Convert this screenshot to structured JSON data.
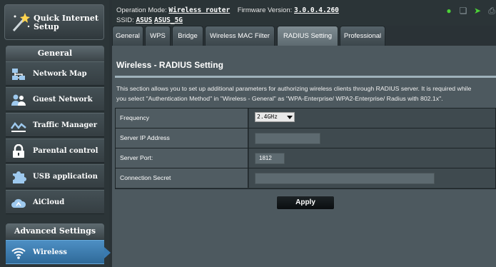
{
  "sidebar": {
    "quick_setup_label": "Quick Internet Setup",
    "general_header": "General",
    "items": [
      {
        "label": "Network Map",
        "icon": "network-map-icon"
      },
      {
        "label": "Guest Network",
        "icon": "guest-network-icon"
      },
      {
        "label": "Traffic Manager",
        "icon": "traffic-manager-icon"
      },
      {
        "label": "Parental control",
        "icon": "lock-icon"
      },
      {
        "label": "USB application",
        "icon": "puzzle-icon"
      },
      {
        "label": "AiCloud",
        "icon": "cloud-icon"
      }
    ],
    "advanced_header": "Advanced Settings",
    "advanced_items": [
      {
        "label": "Wireless",
        "icon": "wifi-icon",
        "active": true
      }
    ]
  },
  "topbar": {
    "operation_mode_label": "Operation Mode:",
    "operation_mode_value": "Wireless router",
    "firmware_label": "Firmware Version:",
    "firmware_value": "3.0.0.4.260",
    "ssid_label": "SSID:",
    "ssid_values": [
      "ASUS",
      "ASUS_5G"
    ],
    "status_icons": [
      "client-status-icon",
      "copy-icon",
      "usb-icon",
      "printer-icon"
    ]
  },
  "tabs": [
    {
      "label": "General"
    },
    {
      "label": "WPS"
    },
    {
      "label": "Bridge"
    },
    {
      "label": "Wireless MAC Filter"
    },
    {
      "label": "RADIUS Setting",
      "active": true
    },
    {
      "label": "Professional"
    }
  ],
  "main": {
    "title": "Wireless - RADIUS Setting",
    "description_line1": "This section allows you to set up additional parameters for authorizing wireless clients through RADIUS server. It is required while",
    "description_line2": "you select \"Authentication Method\" in \"Wireless - General\" as \"WPA-Enterprise/ WPA2-Enterprise/ Radius with 802.1x\".",
    "fields": {
      "frequency": {
        "label": "Frequency",
        "value": "2.4GHz"
      },
      "server_ip": {
        "label": "Server IP Address",
        "value": ""
      },
      "server_port": {
        "label": "Server Port:",
        "value": "1812"
      },
      "secret": {
        "label": "Connection Secret",
        "value": ""
      }
    },
    "apply_label": "Apply"
  },
  "colors": {
    "accent_blue": "#3a7ab0",
    "status_green": "#4cd137",
    "panel": "#4d595f"
  }
}
